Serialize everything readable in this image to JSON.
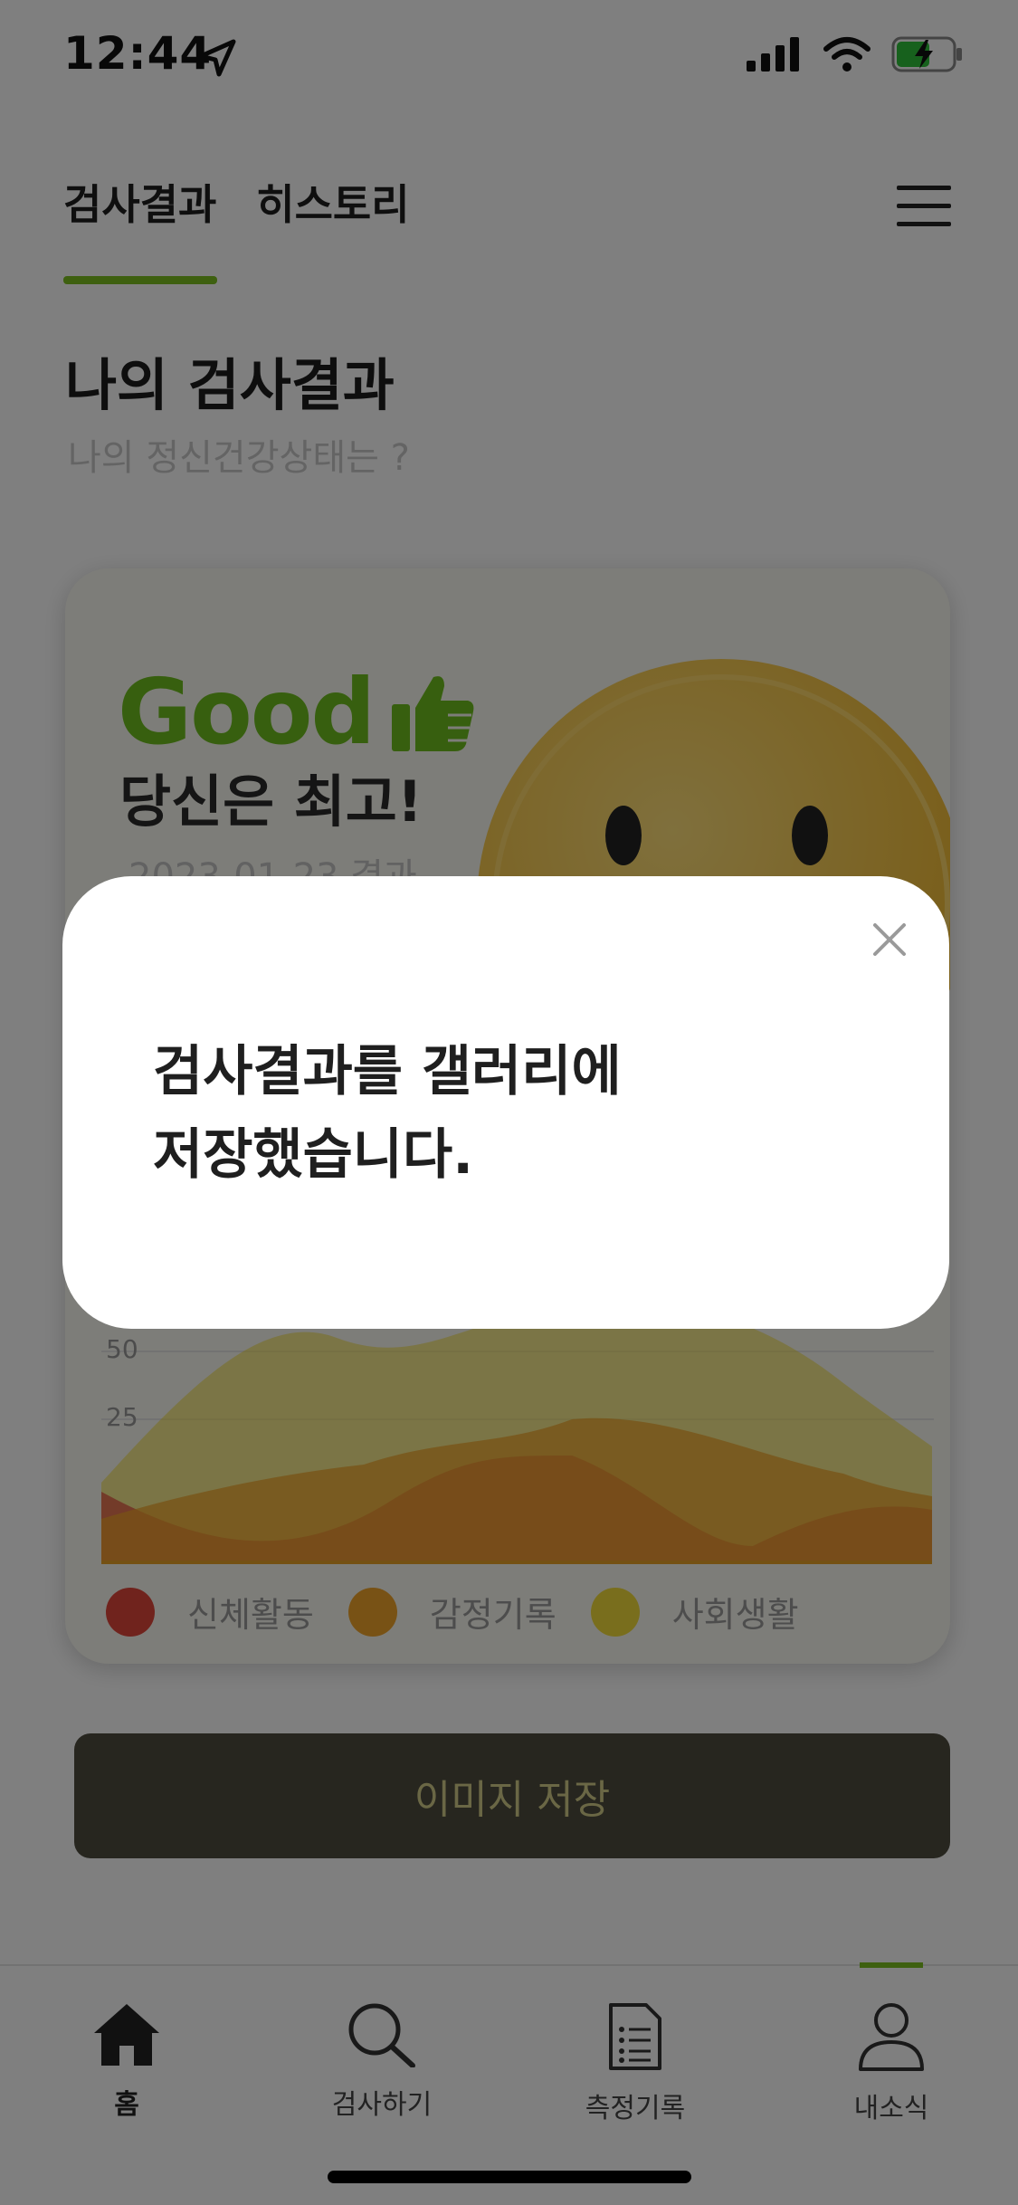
{
  "status_bar": {
    "time": "12:44",
    "icons": [
      "location-arrow-icon",
      "cellular-signal-icon",
      "wifi-icon",
      "battery-charging-icon"
    ]
  },
  "top_tabs": [
    {
      "label": "검사결과",
      "active": true
    },
    {
      "label": "히스토리",
      "active": false
    }
  ],
  "menu": {
    "icon": "hamburger-menu-icon"
  },
  "page": {
    "title": "나의 검사결과",
    "subtitle": "나의 정신건강상태는 ?"
  },
  "result_card": {
    "grade": "Good",
    "grade_icon": "thumbs-up-icon",
    "headline": "당신은 최고!",
    "date_text": "2023-01-23 결과",
    "illustration": "smiley-face-icon"
  },
  "chart_data": {
    "type": "area",
    "yticks": [
      25,
      50
    ],
    "series": [
      {
        "name": "신체활동",
        "color": "#e0463a"
      },
      {
        "name": "감정기록",
        "color": "#f0a42a"
      },
      {
        "name": "사회생활",
        "color": "#f2dc3a"
      }
    ]
  },
  "save_button": {
    "label": "이미지 저장"
  },
  "bottom_nav": [
    {
      "label": "홈",
      "icon": "home-icon",
      "active": false
    },
    {
      "label": "검사하기",
      "icon": "search-icon",
      "active": false
    },
    {
      "label": "측정기록",
      "icon": "document-list-icon",
      "active": false
    },
    {
      "label": "내소식",
      "icon": "person-icon",
      "active": true
    }
  ],
  "modal": {
    "message": "검사결과를 갤러리에\n저장했습니다.",
    "close_icon": "close-icon"
  },
  "colors": {
    "accent_green": "#7cc120",
    "good_green": "#6fbf1e",
    "button_dark": "#4e4c3f",
    "button_text": "#d4cf8a"
  }
}
